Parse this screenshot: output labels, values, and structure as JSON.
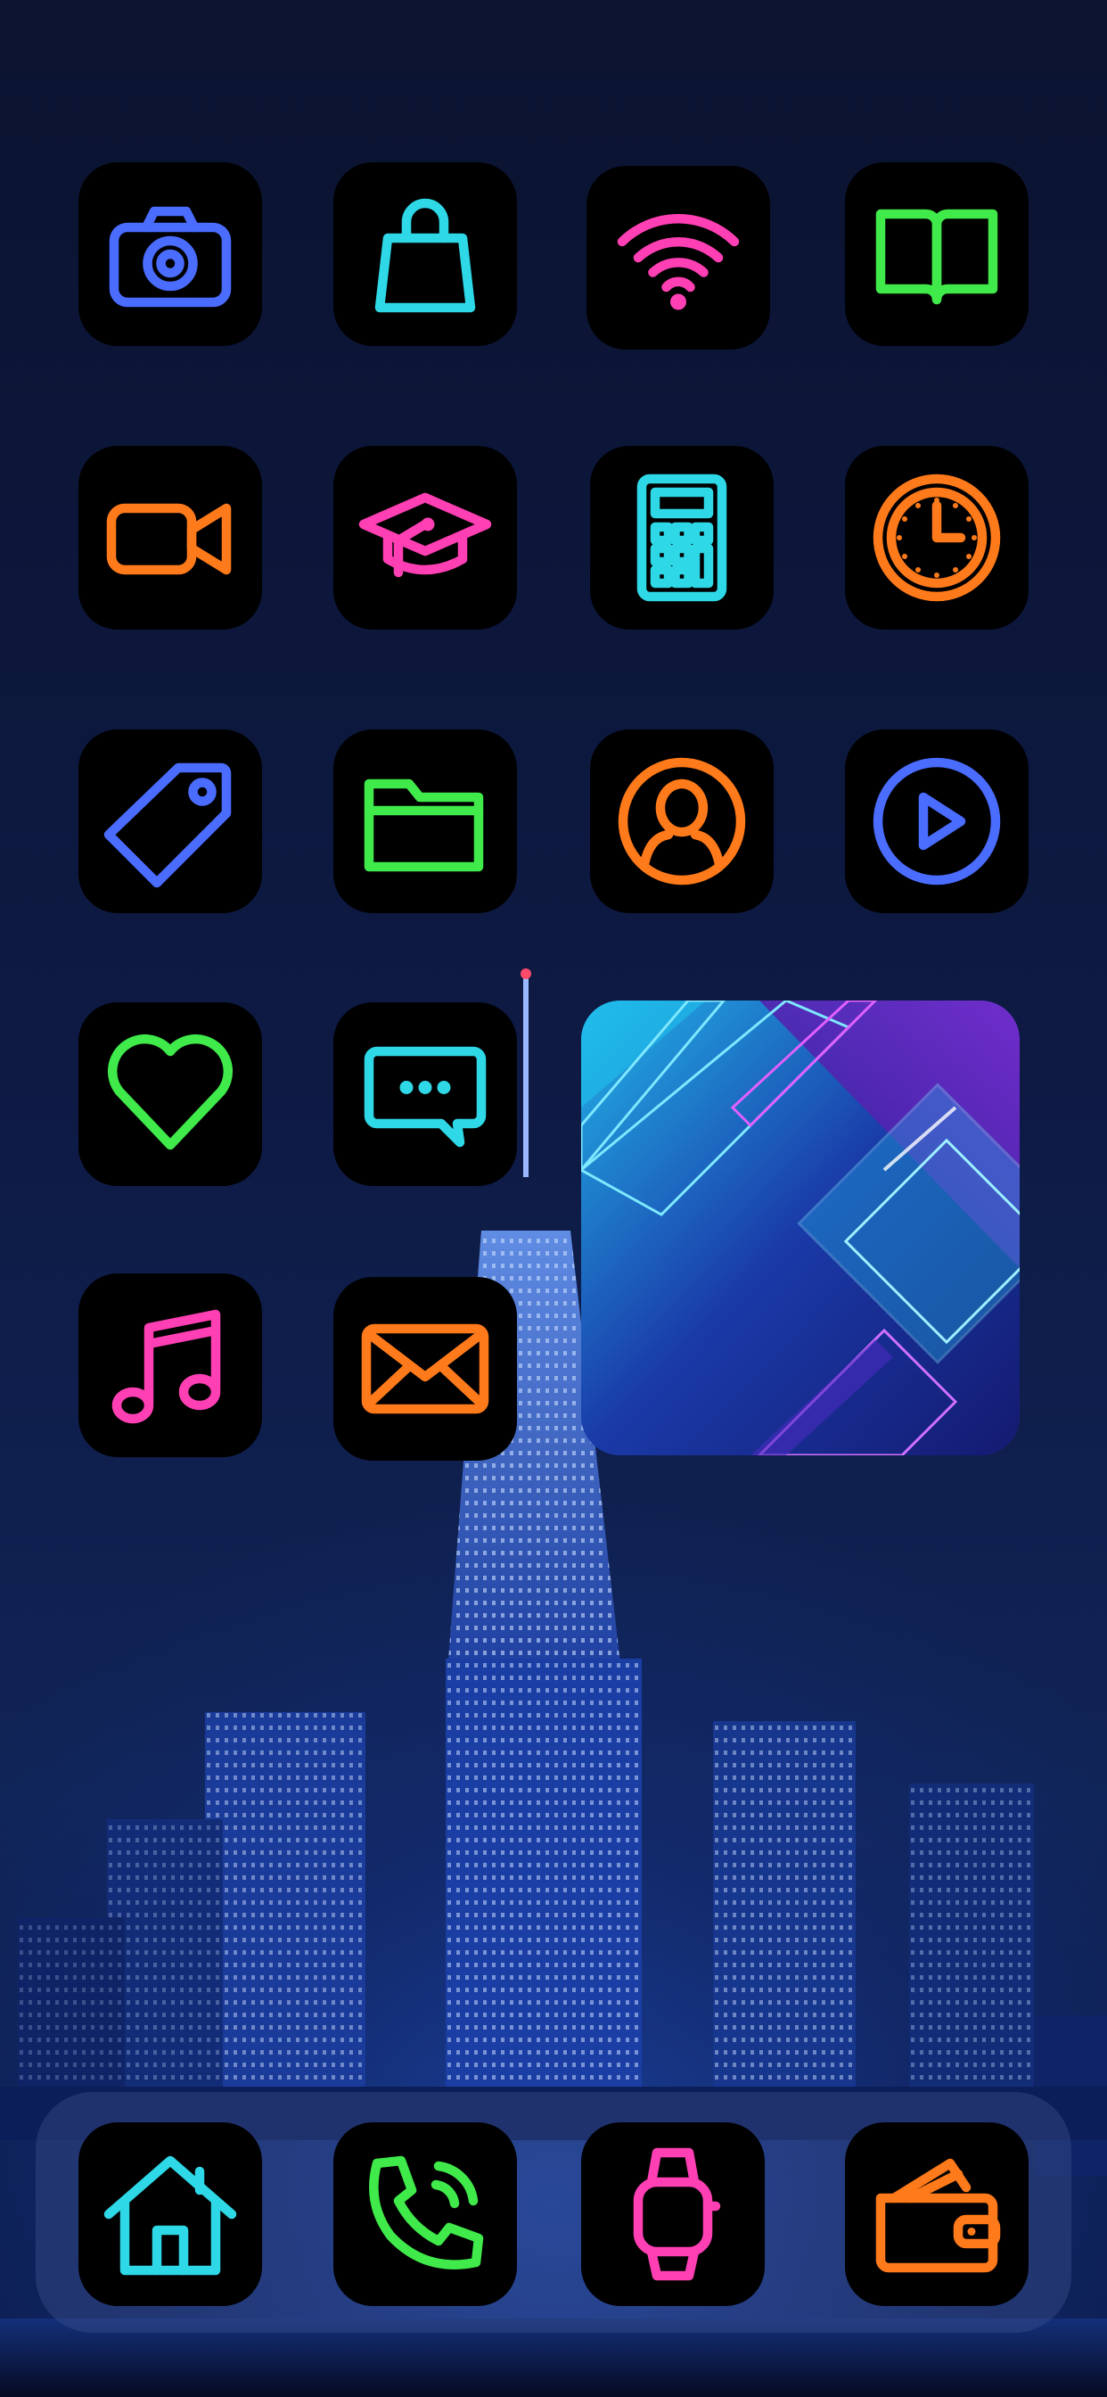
{
  "home_screen": {
    "icons": [
      {
        "name": "camera-icon",
        "color": "#4a6cff"
      },
      {
        "name": "shopping-bag-icon",
        "color": "#2ed8e6"
      },
      {
        "name": "wifi-icon",
        "color": "#ff3fb4"
      },
      {
        "name": "book-icon",
        "color": "#3fea4a"
      },
      {
        "name": "video-camera-icon",
        "color": "#ff7a1a"
      },
      {
        "name": "graduation-cap-icon",
        "color": "#ff3fb4"
      },
      {
        "name": "calculator-icon",
        "color": "#2ed8e6"
      },
      {
        "name": "clock-icon",
        "color": "#ff7a1a"
      },
      {
        "name": "tag-icon",
        "color": "#4a6cff"
      },
      {
        "name": "folder-icon",
        "color": "#3fea4a"
      },
      {
        "name": "contacts-icon",
        "color": "#ff7a1a"
      },
      {
        "name": "play-icon",
        "color": "#4a6cff"
      },
      {
        "name": "heart-icon",
        "color": "#3fea4a"
      },
      {
        "name": "message-icon",
        "color": "#2ed8e6"
      },
      {
        "name": "music-icon",
        "color": "#ff3fb4"
      },
      {
        "name": "mail-icon",
        "color": "#ff7a1a"
      }
    ],
    "widget": {
      "name": "neon-geometric-photo-widget"
    }
  },
  "dock": {
    "icons": [
      {
        "name": "home-icon",
        "color": "#2ed8e6"
      },
      {
        "name": "phone-icon",
        "color": "#3fea4a"
      },
      {
        "name": "watch-icon",
        "color": "#ff3fb4"
      },
      {
        "name": "wallet-icon",
        "color": "#ff7a1a"
      }
    ]
  },
  "wallpaper": {
    "name": "night-city-skyline",
    "accent": "#3a7bff"
  }
}
